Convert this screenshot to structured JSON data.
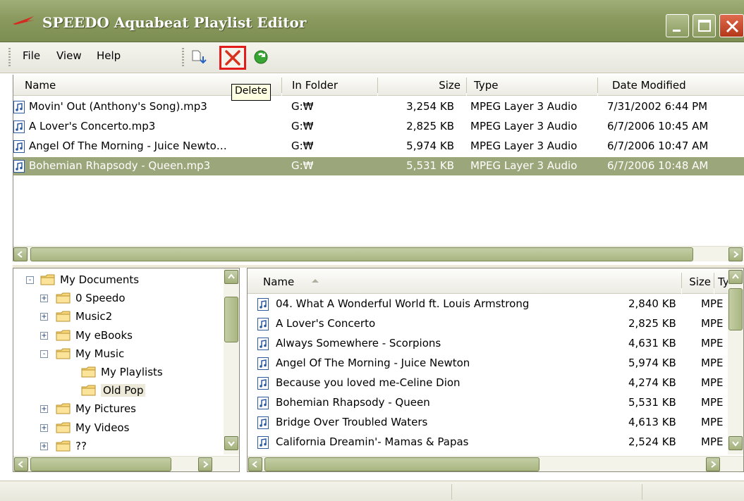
{
  "window": {
    "title": "SPEEDO Aquabeat Playlist Editor",
    "accent": "#8a9a5e",
    "selection_color": "#9ba67a"
  },
  "menu": {
    "file": "File",
    "view": "View",
    "help": "Help"
  },
  "toolbar": {
    "new_icon": "new-playlist-icon",
    "delete_icon": "delete-x-icon",
    "refresh_icon": "refresh-icon"
  },
  "tooltip": "Delete",
  "playlist": {
    "columns": [
      "Name",
      "In Folder",
      "Size",
      "Type",
      "Date Modified"
    ],
    "rows": [
      {
        "name": "Movin' Out (Anthony's Song).mp3",
        "folder": "G:₩",
        "size": "3,254 KB",
        "type": "MPEG Layer 3 Audio",
        "date": "7/31/2002 6:44 PM",
        "selected": false
      },
      {
        "name": "A Lover's Concerto.mp3",
        "folder": "G:₩",
        "size": "2,825 KB",
        "type": "MPEG Layer 3 Audio",
        "date": "6/7/2006 10:45 AM",
        "selected": false
      },
      {
        "name": "Angel Of The Morning - Juice Newto…",
        "folder": "G:₩",
        "size": "5,974 KB",
        "type": "MPEG Layer 3 Audio",
        "date": "6/7/2006 10:47 AM",
        "selected": false
      },
      {
        "name": "Bohemian Rhapsody - Queen.mp3",
        "folder": "G:₩",
        "size": "5,531 KB",
        "type": "MPEG Layer 3 Audio",
        "date": "6/7/2006 10:48 AM",
        "selected": true
      }
    ]
  },
  "tree": {
    "items": [
      {
        "label": "My Documents",
        "toggle": "-",
        "level": 0
      },
      {
        "label": "0 Speedo",
        "toggle": "+",
        "level": 1
      },
      {
        "label": "Music2",
        "toggle": "+",
        "level": 1
      },
      {
        "label": "My eBooks",
        "toggle": "+",
        "level": 1
      },
      {
        "label": "My Music",
        "toggle": "-",
        "level": 1
      },
      {
        "label": "My Playlists",
        "toggle": "",
        "level": 2
      },
      {
        "label": "Old Pop",
        "toggle": "",
        "level": 2
      },
      {
        "label": "My Pictures",
        "toggle": "+",
        "level": 1
      },
      {
        "label": "My Videos",
        "toggle": "+",
        "level": 1
      },
      {
        "label": "??",
        "toggle": "+",
        "level": 1
      }
    ]
  },
  "files": {
    "columns": [
      "Name",
      "Size",
      "Typ"
    ],
    "rows": [
      {
        "name": "04. What A Wonderful World ft. Louis Armstrong",
        "size": "2,840 KB",
        "type": "MPE"
      },
      {
        "name": "A Lover's Concerto",
        "size": "2,825 KB",
        "type": "MPE"
      },
      {
        "name": "Always Somewhere - Scorpions",
        "size": "4,631 KB",
        "type": "MPE"
      },
      {
        "name": "Angel Of The Morning - Juice Newton",
        "size": "5,974 KB",
        "type": "MPE"
      },
      {
        "name": "Because you loved me-Celine Dion",
        "size": "4,274 KB",
        "type": "MPE"
      },
      {
        "name": "Bohemian Rhapsody - Queen",
        "size": "5,531 KB",
        "type": "MPE"
      },
      {
        "name": "Bridge Over Troubled Waters",
        "size": "4,613 KB",
        "type": "MPE"
      },
      {
        "name": "California Dreamin'- Mamas & Papas",
        "size": "2,524 KB",
        "type": "MPE"
      }
    ]
  }
}
